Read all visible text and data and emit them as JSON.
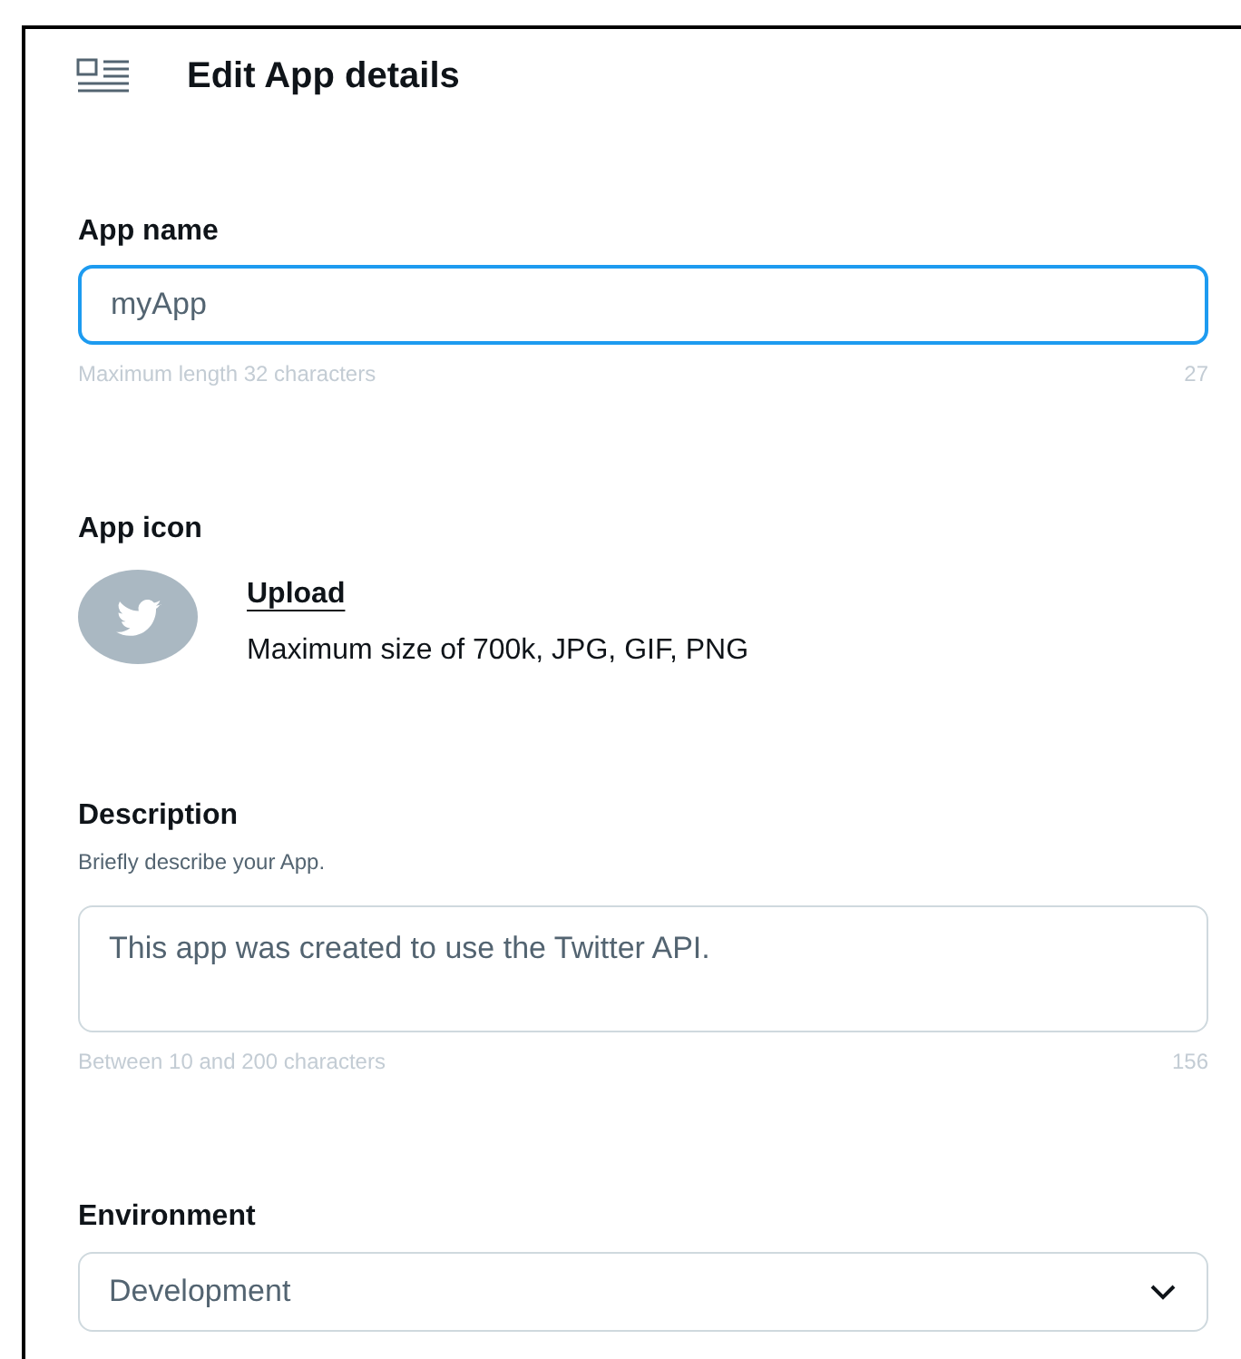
{
  "header": {
    "title": "Edit App details"
  },
  "app_name": {
    "label": "App name",
    "value": "myApp",
    "focused": true,
    "hint": "Maximum length 32 characters",
    "count": "27"
  },
  "app_icon": {
    "label": "App icon",
    "upload": "Upload",
    "note": "Maximum size of 700k, JPG, GIF, PNG"
  },
  "description": {
    "label": "Description",
    "sublabel": "Briefly describe your App.",
    "value": "This app was created to use the Twitter API.",
    "focused": false,
    "hint": "Between 10 and 200 characters",
    "count": "156"
  },
  "environment": {
    "label": "Environment",
    "value": "Development"
  }
}
